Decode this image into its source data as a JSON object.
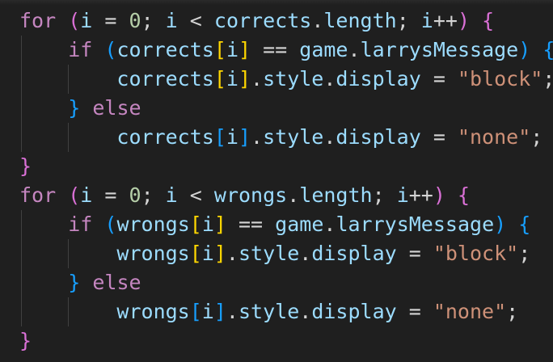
{
  "code": {
    "language": "javascript",
    "lines": [
      {
        "tokens": [
          {
            "t": "for",
            "c": "kw-ctrl"
          },
          {
            "t": " ",
            "c": "op"
          },
          {
            "t": "(",
            "c": "br1"
          },
          {
            "t": "i",
            "c": "var"
          },
          {
            "t": " = ",
            "c": "op"
          },
          {
            "t": "0",
            "c": "num"
          },
          {
            "t": "; ",
            "c": "op"
          },
          {
            "t": "i",
            "c": "var"
          },
          {
            "t": " < ",
            "c": "op"
          },
          {
            "t": "corrects",
            "c": "var"
          },
          {
            "t": ".",
            "c": "op"
          },
          {
            "t": "length",
            "c": "var"
          },
          {
            "t": "; ",
            "c": "op"
          },
          {
            "t": "i",
            "c": "var"
          },
          {
            "t": "++",
            "c": "op"
          },
          {
            "t": ")",
            "c": "br1"
          },
          {
            "t": " ",
            "c": "op"
          },
          {
            "t": "{",
            "c": "br1"
          }
        ]
      },
      {
        "tokens": [
          {
            "t": "    ",
            "c": "op"
          },
          {
            "t": "if",
            "c": "kw-ctrl"
          },
          {
            "t": " ",
            "c": "op"
          },
          {
            "t": "(",
            "c": "br2"
          },
          {
            "t": "corrects",
            "c": "var"
          },
          {
            "t": "[",
            "c": "br3"
          },
          {
            "t": "i",
            "c": "var"
          },
          {
            "t": "]",
            "c": "br3"
          },
          {
            "t": " == ",
            "c": "op"
          },
          {
            "t": "game",
            "c": "var"
          },
          {
            "t": ".",
            "c": "op"
          },
          {
            "t": "larrysMessage",
            "c": "var"
          },
          {
            "t": ")",
            "c": "br2"
          },
          {
            "t": " ",
            "c": "op"
          },
          {
            "t": "{",
            "c": "br2"
          }
        ]
      },
      {
        "tokens": [
          {
            "t": "        ",
            "c": "op"
          },
          {
            "t": "corrects",
            "c": "var"
          },
          {
            "t": "[",
            "c": "br3"
          },
          {
            "t": "i",
            "c": "var"
          },
          {
            "t": "]",
            "c": "br3"
          },
          {
            "t": ".",
            "c": "op"
          },
          {
            "t": "style",
            "c": "var"
          },
          {
            "t": ".",
            "c": "op"
          },
          {
            "t": "display",
            "c": "var"
          },
          {
            "t": " = ",
            "c": "op"
          },
          {
            "t": "\"block\"",
            "c": "str"
          },
          {
            "t": ";",
            "c": "op"
          }
        ]
      },
      {
        "tokens": [
          {
            "t": "    ",
            "c": "op"
          },
          {
            "t": "}",
            "c": "br2"
          },
          {
            "t": " ",
            "c": "op"
          },
          {
            "t": "else",
            "c": "kw-ctrl"
          }
        ]
      },
      {
        "tokens": [
          {
            "t": "        ",
            "c": "op"
          },
          {
            "t": "corrects",
            "c": "var"
          },
          {
            "t": "[",
            "c": "br2"
          },
          {
            "t": "i",
            "c": "var"
          },
          {
            "t": "]",
            "c": "br2"
          },
          {
            "t": ".",
            "c": "op"
          },
          {
            "t": "style",
            "c": "var"
          },
          {
            "t": ".",
            "c": "op"
          },
          {
            "t": "display",
            "c": "var"
          },
          {
            "t": " = ",
            "c": "op"
          },
          {
            "t": "\"none\"",
            "c": "str"
          },
          {
            "t": ";",
            "c": "op"
          }
        ]
      },
      {
        "tokens": [
          {
            "t": "}",
            "c": "br1"
          }
        ]
      },
      {
        "tokens": [
          {
            "t": "for",
            "c": "kw-ctrl"
          },
          {
            "t": " ",
            "c": "op"
          },
          {
            "t": "(",
            "c": "br1"
          },
          {
            "t": "i",
            "c": "var"
          },
          {
            "t": " = ",
            "c": "op"
          },
          {
            "t": "0",
            "c": "num"
          },
          {
            "t": "; ",
            "c": "op"
          },
          {
            "t": "i",
            "c": "var"
          },
          {
            "t": " < ",
            "c": "op"
          },
          {
            "t": "wrongs",
            "c": "var"
          },
          {
            "t": ".",
            "c": "op"
          },
          {
            "t": "length",
            "c": "var"
          },
          {
            "t": "; ",
            "c": "op"
          },
          {
            "t": "i",
            "c": "var"
          },
          {
            "t": "++",
            "c": "op"
          },
          {
            "t": ")",
            "c": "br1"
          },
          {
            "t": " ",
            "c": "op"
          },
          {
            "t": "{",
            "c": "br1"
          }
        ]
      },
      {
        "tokens": [
          {
            "t": "    ",
            "c": "op"
          },
          {
            "t": "if",
            "c": "kw-ctrl"
          },
          {
            "t": " ",
            "c": "op"
          },
          {
            "t": "(",
            "c": "br2"
          },
          {
            "t": "wrongs",
            "c": "var"
          },
          {
            "t": "[",
            "c": "br3"
          },
          {
            "t": "i",
            "c": "var"
          },
          {
            "t": "]",
            "c": "br3"
          },
          {
            "t": " == ",
            "c": "op"
          },
          {
            "t": "game",
            "c": "var"
          },
          {
            "t": ".",
            "c": "op"
          },
          {
            "t": "larrysMessage",
            "c": "var"
          },
          {
            "t": ")",
            "c": "br2"
          },
          {
            "t": " ",
            "c": "op"
          },
          {
            "t": "{",
            "c": "br2"
          }
        ]
      },
      {
        "tokens": [
          {
            "t": "        ",
            "c": "op"
          },
          {
            "t": "wrongs",
            "c": "var"
          },
          {
            "t": "[",
            "c": "br3"
          },
          {
            "t": "i",
            "c": "var"
          },
          {
            "t": "]",
            "c": "br3"
          },
          {
            "t": ".",
            "c": "op"
          },
          {
            "t": "style",
            "c": "var"
          },
          {
            "t": ".",
            "c": "op"
          },
          {
            "t": "display",
            "c": "var"
          },
          {
            "t": " = ",
            "c": "op"
          },
          {
            "t": "\"block\"",
            "c": "str"
          },
          {
            "t": ";",
            "c": "op"
          }
        ]
      },
      {
        "tokens": [
          {
            "t": "    ",
            "c": "op"
          },
          {
            "t": "}",
            "c": "br2"
          },
          {
            "t": " ",
            "c": "op"
          },
          {
            "t": "else",
            "c": "kw-ctrl"
          }
        ]
      },
      {
        "tokens": [
          {
            "t": "        ",
            "c": "op"
          },
          {
            "t": "wrongs",
            "c": "var"
          },
          {
            "t": "[",
            "c": "br2"
          },
          {
            "t": "i",
            "c": "var"
          },
          {
            "t": "]",
            "c": "br2"
          },
          {
            "t": ".",
            "c": "op"
          },
          {
            "t": "style",
            "c": "var"
          },
          {
            "t": ".",
            "c": "op"
          },
          {
            "t": "display",
            "c": "var"
          },
          {
            "t": " = ",
            "c": "op"
          },
          {
            "t": "\"none\"",
            "c": "str"
          },
          {
            "t": ";",
            "c": "op"
          }
        ]
      },
      {
        "tokens": [
          {
            "t": "}",
            "c": "br1"
          }
        ]
      }
    ]
  },
  "colors": {
    "background": "#1f1f1f",
    "keyword": "#c586c0",
    "variable": "#9cdcfe",
    "number": "#b5cea8",
    "string": "#ce9178",
    "bracket_level_1": "#da70d6",
    "bracket_level_2": "#179fff",
    "bracket_level_3": "#ffd700",
    "indent_guide": "#404040"
  }
}
